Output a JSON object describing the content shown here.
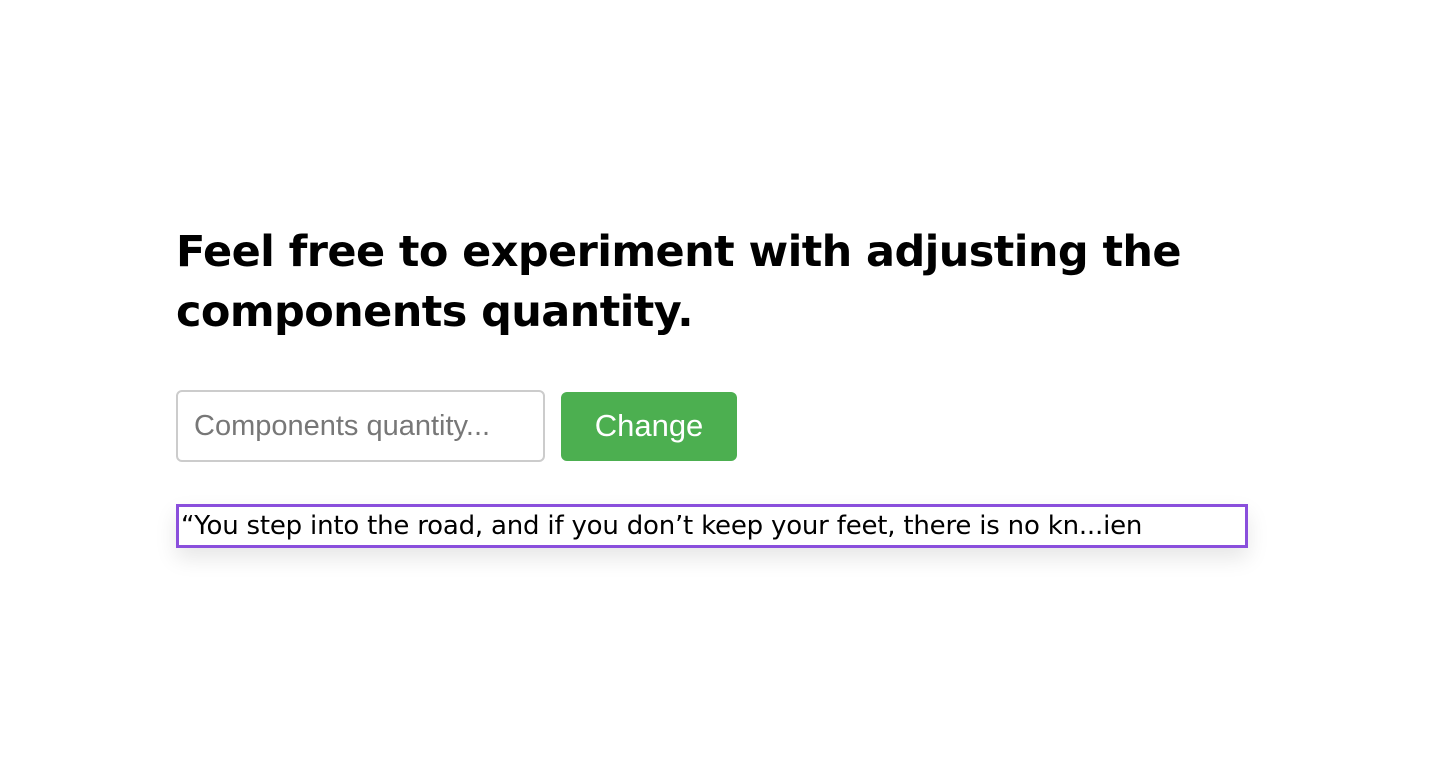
{
  "page": {
    "heading": "Feel free to experiment with adjusting the components quantity."
  },
  "controls": {
    "quantity_placeholder": "Components quantity...",
    "quantity_value": "",
    "change_label": "Change"
  },
  "quote": {
    "text": "“You step into the road, and if you don’t keep your feet, there is no kn...ien"
  },
  "colors": {
    "button_bg": "#4caf50",
    "button_text": "#ffffff",
    "quote_border": "#8a4fdc",
    "input_border": "#cccccc"
  }
}
